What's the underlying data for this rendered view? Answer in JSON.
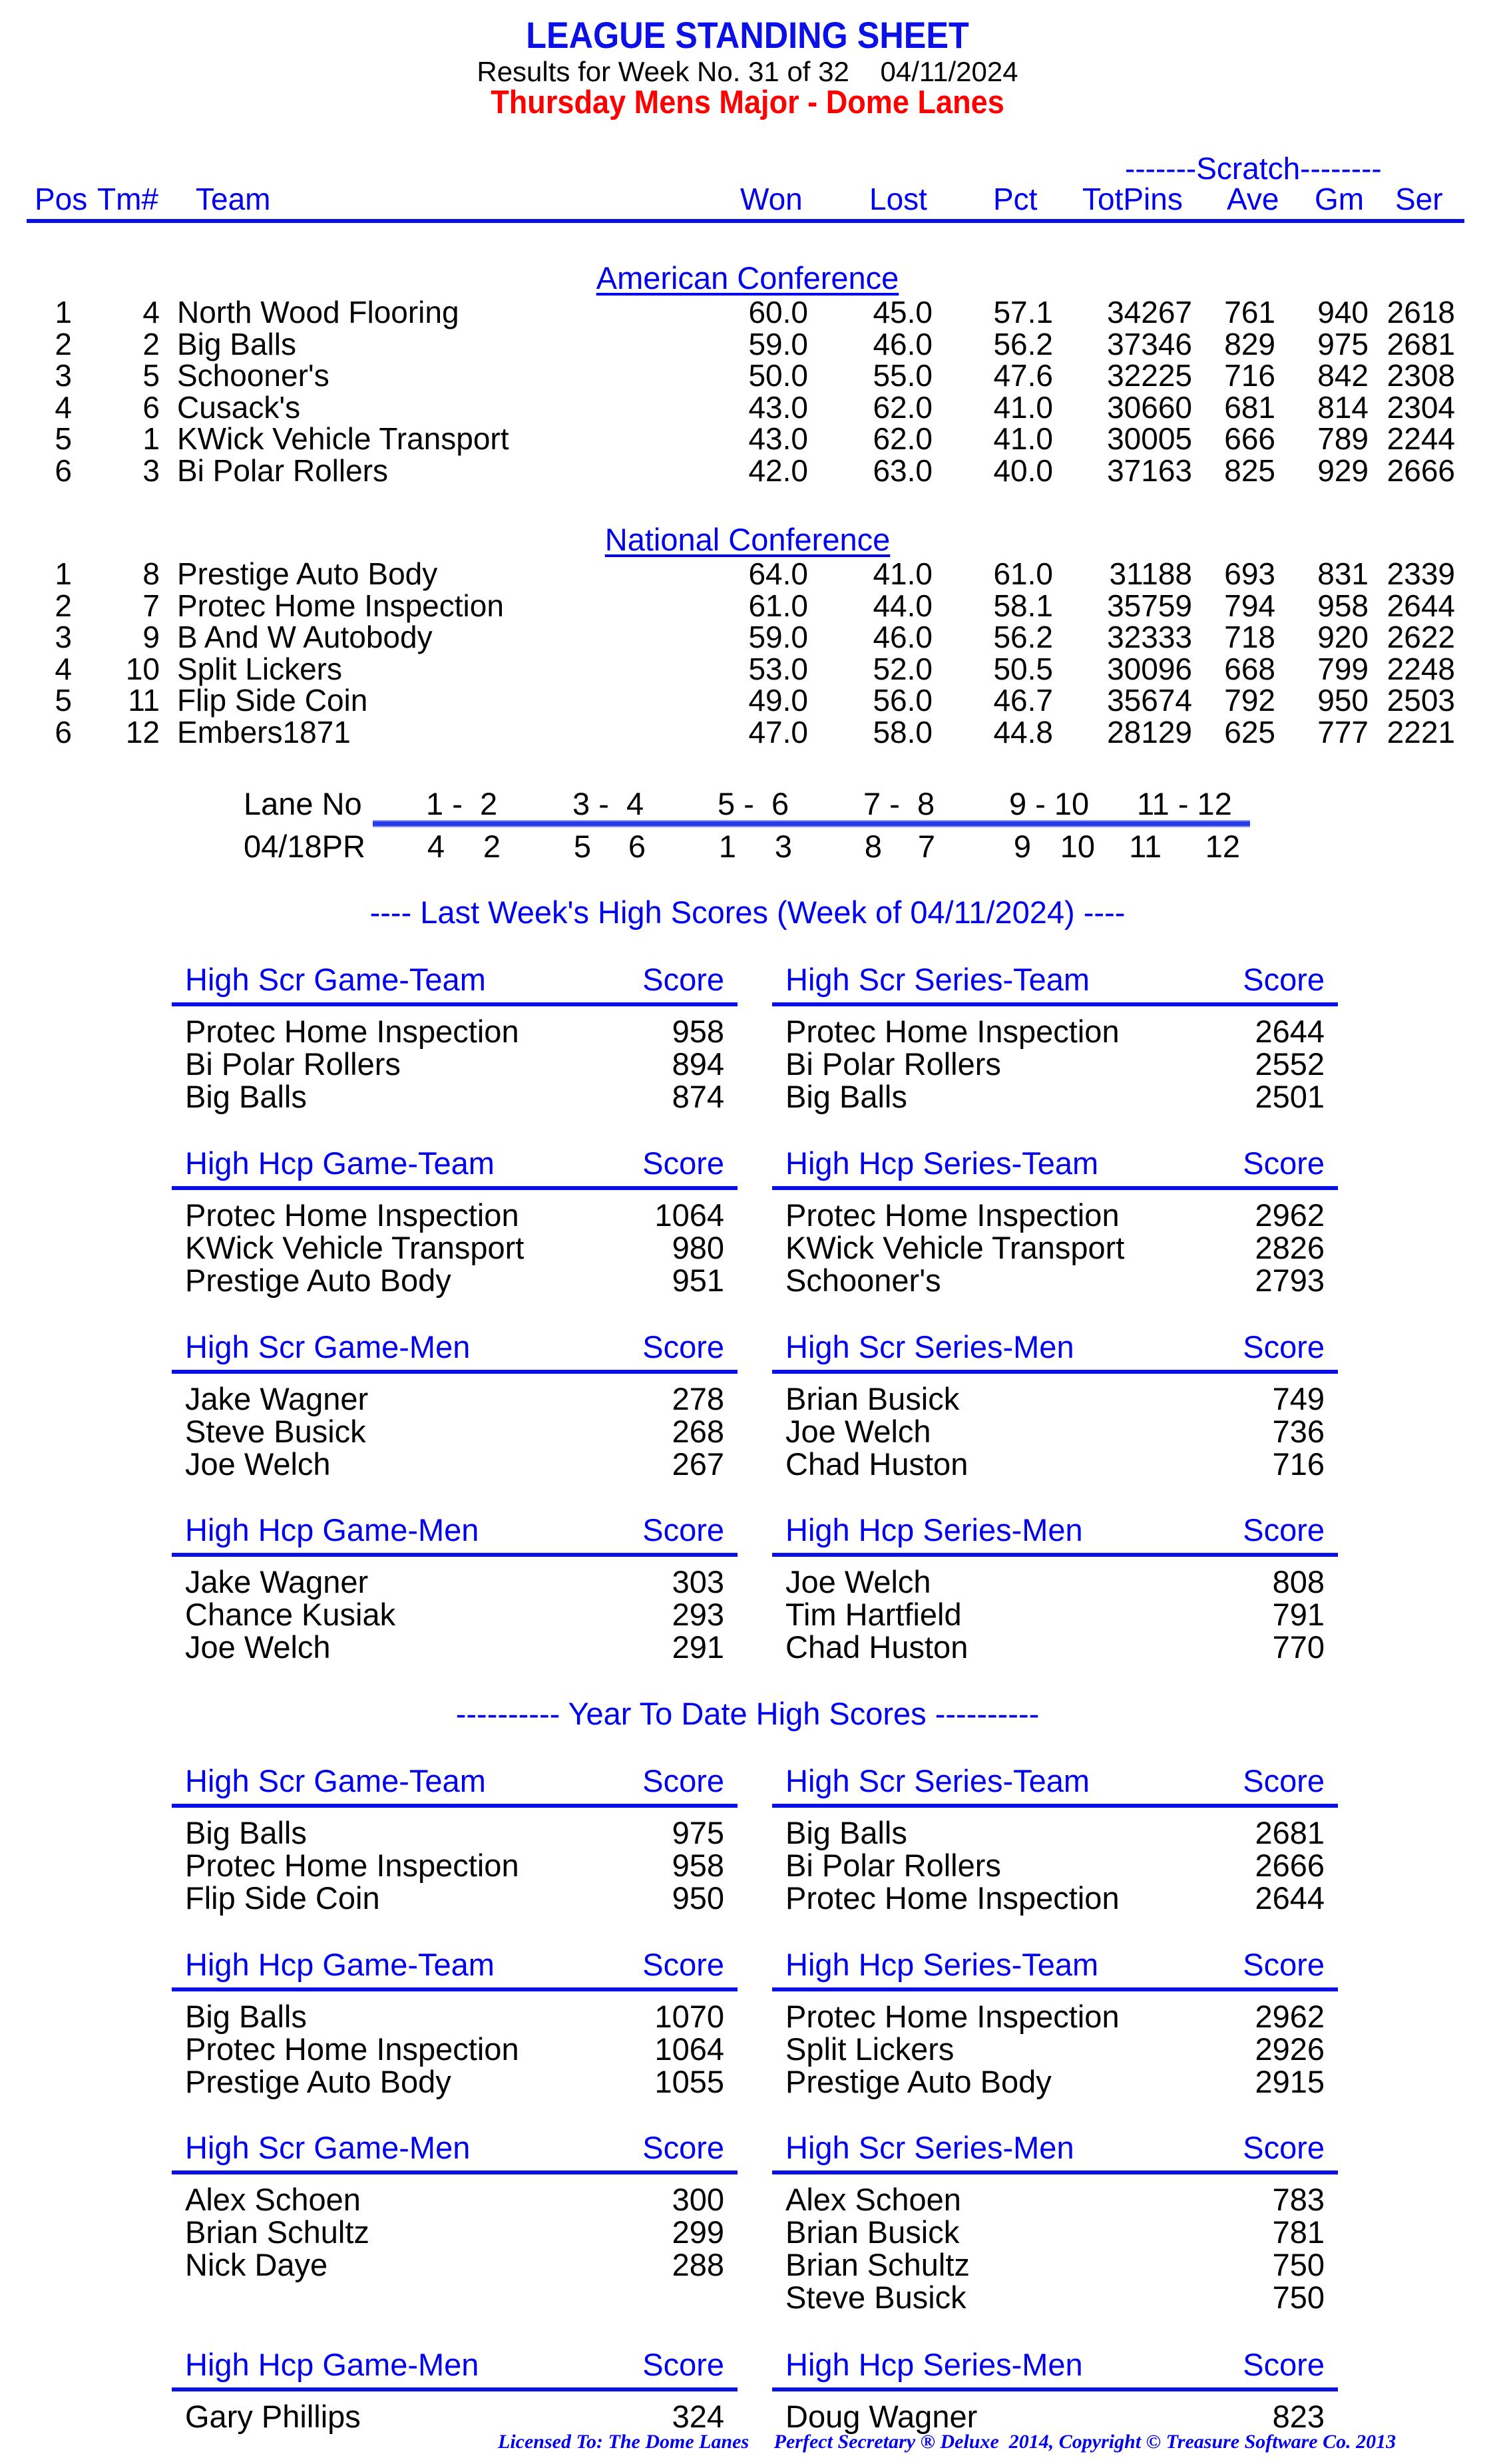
{
  "header": {
    "title": "LEAGUE STANDING SHEET",
    "subtitle": "Results for Week No. 31 of 32    04/11/2024",
    "league": "Thursday Mens Major - Dome Lanes"
  },
  "standings": {
    "scratch_label": "-------Scratch--------",
    "columns": [
      "Pos",
      "Tm#",
      "Team",
      "Won",
      "Lost",
      "Pct",
      "TotPins",
      "Ave",
      "Gm",
      "Ser"
    ],
    "conferences": [
      {
        "name": "American Conference",
        "rows": [
          {
            "pos": "1",
            "tm": "4",
            "team": "North Wood Flooring",
            "won": "60.0",
            "lost": "45.0",
            "pct": "57.1",
            "totpins": "34267",
            "ave": "761",
            "gm": "940",
            "ser": "2618"
          },
          {
            "pos": "2",
            "tm": "2",
            "team": "Big Balls",
            "won": "59.0",
            "lost": "46.0",
            "pct": "56.2",
            "totpins": "37346",
            "ave": "829",
            "gm": "975",
            "ser": "2681"
          },
          {
            "pos": "3",
            "tm": "5",
            "team": "Schooner's",
            "won": "50.0",
            "lost": "55.0",
            "pct": "47.6",
            "totpins": "32225",
            "ave": "716",
            "gm": "842",
            "ser": "2308"
          },
          {
            "pos": "4",
            "tm": "6",
            "team": "Cusack's",
            "won": "43.0",
            "lost": "62.0",
            "pct": "41.0",
            "totpins": "30660",
            "ave": "681",
            "gm": "814",
            "ser": "2304"
          },
          {
            "pos": "5",
            "tm": "1",
            "team": "KWick Vehicle Transport",
            "won": "43.0",
            "lost": "62.0",
            "pct": "41.0",
            "totpins": "30005",
            "ave": "666",
            "gm": "789",
            "ser": "2244"
          },
          {
            "pos": "6",
            "tm": "3",
            "team": "Bi Polar Rollers",
            "won": "42.0",
            "lost": "63.0",
            "pct": "40.0",
            "totpins": "37163",
            "ave": "825",
            "gm": "929",
            "ser": "2666"
          }
        ]
      },
      {
        "name": "National Conference",
        "rows": [
          {
            "pos": "1",
            "tm": "8",
            "team": "Prestige Auto Body",
            "won": "64.0",
            "lost": "41.0",
            "pct": "61.0",
            "totpins": "31188",
            "ave": "693",
            "gm": "831",
            "ser": "2339"
          },
          {
            "pos": "2",
            "tm": "7",
            "team": "Protec Home Inspection",
            "won": "61.0",
            "lost": "44.0",
            "pct": "58.1",
            "totpins": "35759",
            "ave": "794",
            "gm": "958",
            "ser": "2644"
          },
          {
            "pos": "3",
            "tm": "9",
            "team": "B And W Autobody",
            "won": "59.0",
            "lost": "46.0",
            "pct": "56.2",
            "totpins": "32333",
            "ave": "718",
            "gm": "920",
            "ser": "2622"
          },
          {
            "pos": "4",
            "tm": "10",
            "team": "Split Lickers",
            "won": "53.0",
            "lost": "52.0",
            "pct": "50.5",
            "totpins": "30096",
            "ave": "668",
            "gm": "799",
            "ser": "2248"
          },
          {
            "pos": "5",
            "tm": "11",
            "team": "Flip Side Coin",
            "won": "49.0",
            "lost": "56.0",
            "pct": "46.7",
            "totpins": "35674",
            "ave": "792",
            "gm": "950",
            "ser": "2503"
          },
          {
            "pos": "6",
            "tm": "12",
            "team": "Embers1871",
            "won": "47.0",
            "lost": "58.0",
            "pct": "44.8",
            "totpins": "28129",
            "ave": "625",
            "gm": "777",
            "ser": "2221"
          }
        ]
      }
    ]
  },
  "lanes": {
    "label": "Lane No",
    "pairs": [
      "1 -  2",
      "3 -  4",
      "5 -  6",
      "7 -  8",
      "9 - 10",
      "11 - 12"
    ],
    "next_label": "04/18PR",
    "next": [
      [
        "4",
        "2"
      ],
      [
        "5",
        "6"
      ],
      [
        "1",
        "3"
      ],
      [
        "8",
        "7"
      ],
      [
        "9",
        "10"
      ],
      [
        "11",
        "12"
      ]
    ]
  },
  "last_week": {
    "heading": "----  Last Week's High Scores   (Week of 04/11/2024)  ----",
    "boxes": [
      {
        "title": "High Scr Game-Team",
        "score_label": "Score",
        "items": [
          {
            "name": "Protec Home Inspection",
            "score": "958"
          },
          {
            "name": "Bi Polar Rollers",
            "score": "894"
          },
          {
            "name": "Big Balls",
            "score": "874"
          }
        ]
      },
      {
        "title": "High Scr Series-Team",
        "score_label": "Score",
        "items": [
          {
            "name": "Protec Home Inspection",
            "score": "2644"
          },
          {
            "name": "Bi Polar Rollers",
            "score": "2552"
          },
          {
            "name": "Big Balls",
            "score": "2501"
          }
        ]
      },
      {
        "title": "High Hcp Game-Team",
        "score_label": "Score",
        "items": [
          {
            "name": "Protec Home Inspection",
            "score": "1064"
          },
          {
            "name": "KWick Vehicle Transport",
            "score": "980"
          },
          {
            "name": "Prestige Auto Body",
            "score": "951"
          }
        ]
      },
      {
        "title": "High Hcp Series-Team",
        "score_label": "Score",
        "items": [
          {
            "name": "Protec Home Inspection",
            "score": "2962"
          },
          {
            "name": "KWick Vehicle Transport",
            "score": "2826"
          },
          {
            "name": "Schooner's",
            "score": "2793"
          }
        ]
      },
      {
        "title": "High Scr Game-Men",
        "score_label": "Score",
        "items": [
          {
            "name": "Jake Wagner",
            "score": "278"
          },
          {
            "name": "Steve Busick",
            "score": "268"
          },
          {
            "name": "Joe Welch",
            "score": "267"
          }
        ]
      },
      {
        "title": "High Scr Series-Men",
        "score_label": "Score",
        "items": [
          {
            "name": "Brian Busick",
            "score": "749"
          },
          {
            "name": "Joe Welch",
            "score": "736"
          },
          {
            "name": "Chad Huston",
            "score": "716"
          }
        ]
      },
      {
        "title": "High Hcp Game-Men",
        "score_label": "Score",
        "items": [
          {
            "name": "Jake Wagner",
            "score": "303"
          },
          {
            "name": "Chance Kusiak",
            "score": "293"
          },
          {
            "name": "Joe Welch",
            "score": "291"
          }
        ]
      },
      {
        "title": "High Hcp Series-Men",
        "score_label": "Score",
        "items": [
          {
            "name": "Joe Welch",
            "score": "808"
          },
          {
            "name": "Tim Hartfield",
            "score": "791"
          },
          {
            "name": "Chad Huston",
            "score": "770"
          }
        ]
      }
    ]
  },
  "year_to_date": {
    "heading": "---------- Year To Date High Scores ----------",
    "boxes": [
      {
        "title": "High Scr Game-Team",
        "score_label": "Score",
        "items": [
          {
            "name": "Big Balls",
            "score": "975"
          },
          {
            "name": "Protec Home Inspection",
            "score": "958"
          },
          {
            "name": "Flip Side Coin",
            "score": "950"
          }
        ]
      },
      {
        "title": "High Scr Series-Team",
        "score_label": "Score",
        "items": [
          {
            "name": "Big Balls",
            "score": "2681"
          },
          {
            "name": "Bi Polar Rollers",
            "score": "2666"
          },
          {
            "name": "Protec Home Inspection",
            "score": "2644"
          }
        ]
      },
      {
        "title": "High Hcp Game-Team",
        "score_label": "Score",
        "items": [
          {
            "name": "Big Balls",
            "score": "1070"
          },
          {
            "name": "Protec Home Inspection",
            "score": "1064"
          },
          {
            "name": "Prestige Auto Body",
            "score": "1055"
          }
        ]
      },
      {
        "title": "High Hcp Series-Team",
        "score_label": "Score",
        "items": [
          {
            "name": "Protec Home Inspection",
            "score": "2962"
          },
          {
            "name": "Split Lickers",
            "score": "2926"
          },
          {
            "name": "Prestige Auto Body",
            "score": "2915"
          }
        ]
      },
      {
        "title": "High Scr Game-Men",
        "score_label": "Score",
        "items": [
          {
            "name": "Alex Schoen",
            "score": "300"
          },
          {
            "name": "Brian Schultz",
            "score": "299"
          },
          {
            "name": "Nick Daye",
            "score": "288"
          }
        ]
      },
      {
        "title": "High Scr Series-Men",
        "score_label": "Score",
        "items": [
          {
            "name": "Alex Schoen",
            "score": "783"
          },
          {
            "name": "Brian Busick",
            "score": "781"
          },
          {
            "name": "Brian Schultz",
            "score": "750"
          },
          {
            "name": "Steve Busick",
            "score": "750"
          }
        ]
      },
      {
        "title": "High Hcp Game-Men",
        "score_label": "Score",
        "items": [
          {
            "name": "Gary Phillips",
            "score": "324"
          }
        ]
      },
      {
        "title": "High Hcp Series-Men",
        "score_label": "Score",
        "items": [
          {
            "name": "Doug Wagner",
            "score": "823"
          }
        ]
      }
    ]
  },
  "footer": "Licensed To: The Dome Lanes     Perfect Secretary ® Deluxe  2014, Copyright © Treasure Software Co. 2013"
}
